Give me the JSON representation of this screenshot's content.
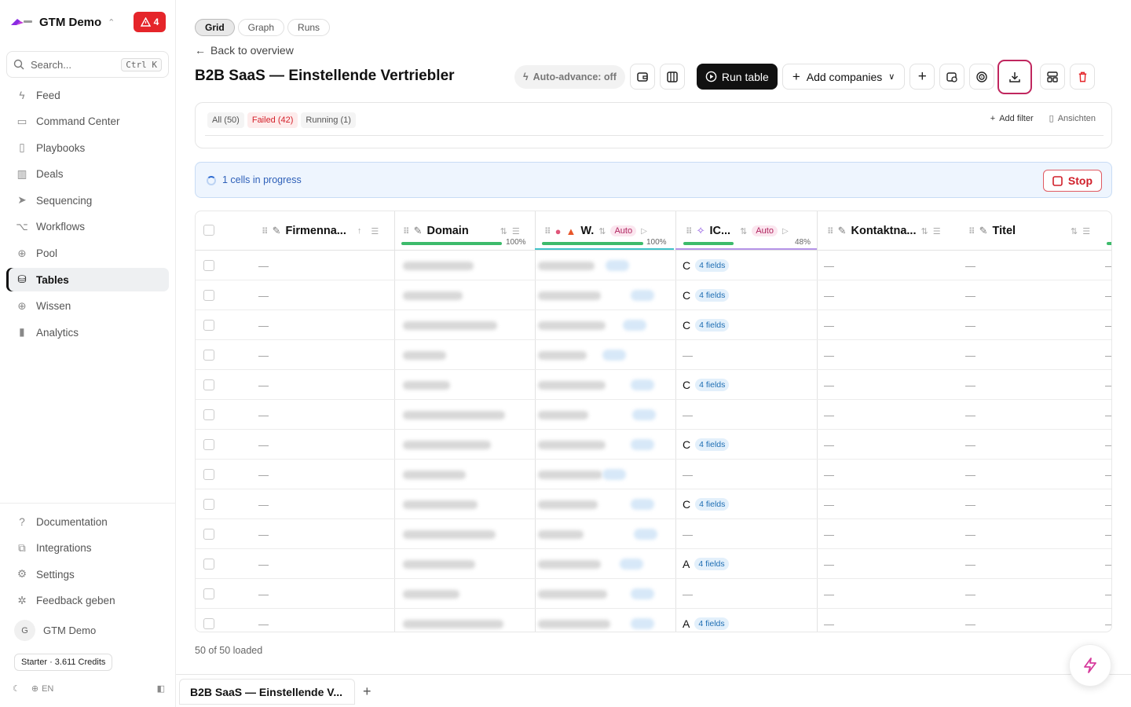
{
  "app": {
    "workspace": "GTM Demo",
    "alert_count": "4"
  },
  "search": {
    "placeholder": "Search...",
    "shortcut": "Ctrl K"
  },
  "nav": [
    {
      "label": "Feed",
      "icon": "bolt-icon"
    },
    {
      "label": "Command Center",
      "icon": "briefcase-icon"
    },
    {
      "label": "Playbooks",
      "icon": "book-icon"
    },
    {
      "label": "Deals",
      "icon": "kanban-icon"
    },
    {
      "label": "Sequencing",
      "icon": "send-icon"
    },
    {
      "label": "Workflows",
      "icon": "workflow-icon"
    },
    {
      "label": "Pool",
      "icon": "globe-icon"
    },
    {
      "label": "Tables",
      "icon": "database-icon",
      "active": true
    },
    {
      "label": "Wissen",
      "icon": "globe-icon"
    },
    {
      "label": "Analytics",
      "icon": "bar-chart-icon"
    }
  ],
  "bottom_nav": [
    {
      "label": "Documentation",
      "icon": "help-icon"
    },
    {
      "label": "Integrations",
      "icon": "puzzle-icon"
    },
    {
      "label": "Settings",
      "icon": "gear-icon"
    },
    {
      "label": "Feedback geben",
      "icon": "bug-icon"
    }
  ],
  "user": {
    "initial": "G",
    "name": "GTM Demo"
  },
  "credits": "Starter · 3.611 Credits",
  "lang": "EN",
  "view_tabs": [
    "Grid",
    "Graph",
    "Runs"
  ],
  "back_link": "Back to overview",
  "page_title": "B2B SaaS — Einstellende Vertriebler",
  "toolbar": {
    "auto_advance": "Auto-advance: off",
    "run_table": "Run table",
    "add_companies": "Add companies"
  },
  "filters": {
    "all": "All (50)",
    "failed": "Failed (42)",
    "running": "Running (1)",
    "add_filter": "Add filter",
    "views": "Ansichten"
  },
  "progress": {
    "text": "1 cells in progress",
    "stop": "Stop"
  },
  "columns": {
    "firma": "Firmenna...",
    "domain": "Domain",
    "w": "W.",
    "ic": "IC...",
    "kontakt": "Kontaktna...",
    "titel": "Titel",
    "auto": "Auto",
    "domain_pct": "100%",
    "w_pct": "100%",
    "ic_pct": "48%"
  },
  "rows": [
    {
      "grade": "C",
      "fields": "4 fields"
    },
    {
      "grade": "C",
      "fields": "4 fields"
    },
    {
      "grade": "C",
      "fields": "4 fields"
    },
    {
      "grade": "",
      "fields": ""
    },
    {
      "grade": "C",
      "fields": "4 fields"
    },
    {
      "grade": "",
      "fields": ""
    },
    {
      "grade": "C",
      "fields": "4 fields"
    },
    {
      "grade": "",
      "fields": ""
    },
    {
      "grade": "C",
      "fields": "4 fields"
    },
    {
      "grade": "",
      "fields": ""
    },
    {
      "grade": "A",
      "fields": "4 fields"
    },
    {
      "grade": "",
      "fields": ""
    },
    {
      "grade": "A",
      "fields": "4 fields"
    }
  ],
  "empty_cell": "—",
  "loaded": "50 of 50 loaded",
  "bottom_tab": "B2B SaaS — Einstellende V..."
}
